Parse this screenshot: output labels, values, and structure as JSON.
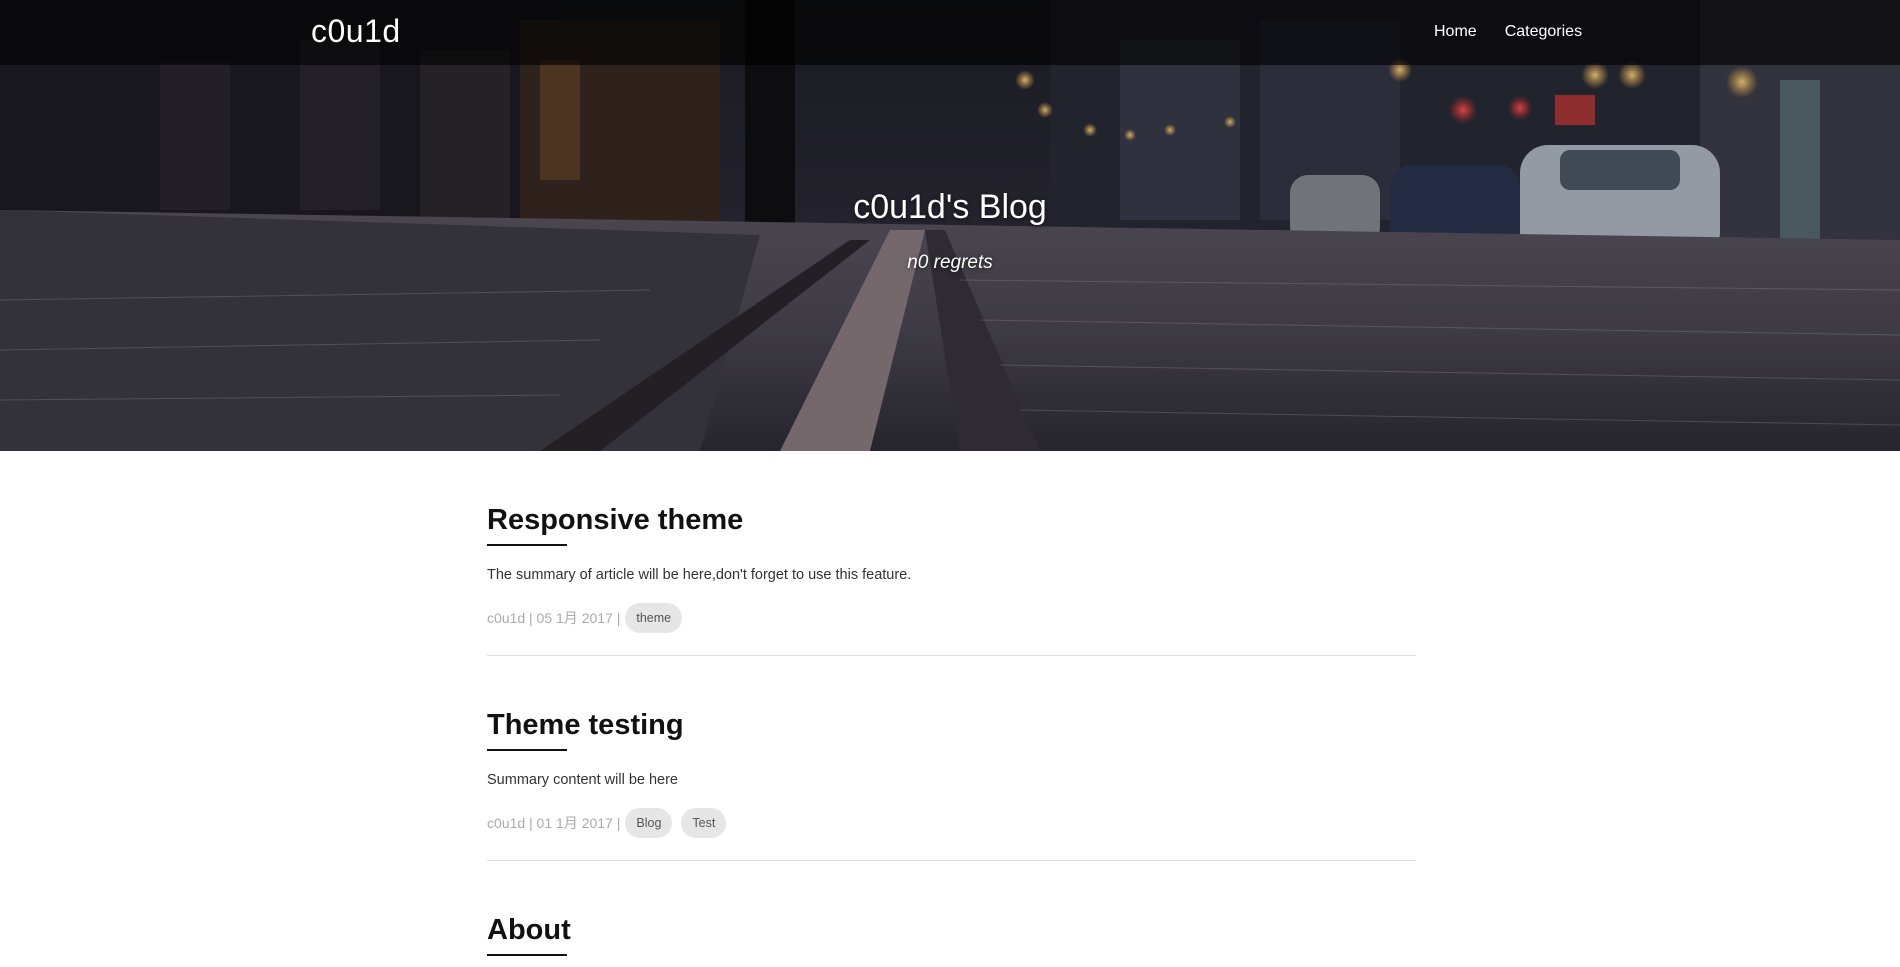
{
  "nav": {
    "brand": "c0u1d",
    "links": [
      "Home",
      "Categories"
    ]
  },
  "hero": {
    "title": "c0u1d's Blog",
    "subtitle": "n0 regrets"
  },
  "posts": [
    {
      "title": "Responsive theme",
      "summary": "The summary of article will be here,don't forget to use this feature.",
      "meta": "c0u1d | 05 1月 2017 |",
      "tags": [
        "theme"
      ]
    },
    {
      "title": "Theme testing",
      "summary": "Summary content will be here",
      "meta": "c0u1d | 01 1月 2017 |",
      "tags": [
        "Blog",
        "Test"
      ]
    },
    {
      "title": "About"
    }
  ]
}
